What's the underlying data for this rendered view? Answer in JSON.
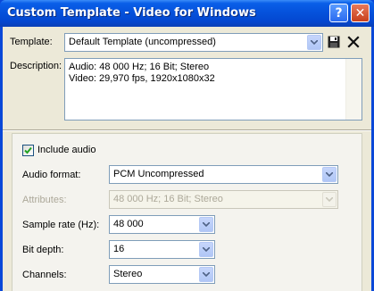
{
  "window": {
    "title": "Custom Template - Video for Windows",
    "help_glyph": "?",
    "close_glyph": "✕"
  },
  "template": {
    "label": "Template:",
    "value": "Default Template (uncompressed)"
  },
  "description": {
    "label": "Description:",
    "lines": [
      "Audio: 48 000 Hz; 16 Bit; Stereo",
      "Video: 29,970 fps, 1920x1080x32"
    ]
  },
  "audio": {
    "include_label": "Include audio",
    "include_checked": true,
    "format_label": "Audio format:",
    "format_value": "PCM Uncompressed",
    "attributes_label": "Attributes:",
    "attributes_value": "48 000 Hz; 16 Bit; Stereo",
    "sample_rate_label": "Sample rate (Hz):",
    "sample_rate_value": "48 000",
    "bit_depth_label": "Bit depth:",
    "bit_depth_value": "16",
    "channels_label": "Channels:",
    "channels_value": "Stereo"
  },
  "icons": {
    "save": "floppy-disk-icon",
    "delete": "x-delete-icon",
    "dropdown": "chevron-down-icon"
  },
  "colors": {
    "titlebar": "#0552dc",
    "dialog_bg": "#ece9d8",
    "panel_bg": "#f4f3ee",
    "field_border": "#7f9db9",
    "close_button": "#c8401c",
    "disabled_text": "#aca899"
  }
}
